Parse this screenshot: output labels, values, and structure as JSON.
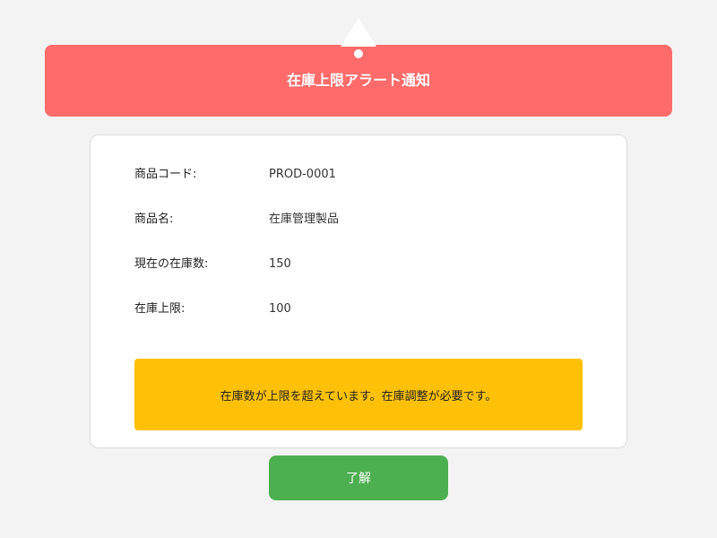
{
  "header": {
    "title": "在庫上限アラート通知",
    "icon": "warning-icon",
    "background_color": "#ff6b6b"
  },
  "details": {
    "rows": [
      {
        "label": "商品コード:",
        "value": "PROD-0001"
      },
      {
        "label": "商品名:",
        "value": "在庫管理製品"
      },
      {
        "label": "現在の在庫数:",
        "value": "150"
      },
      {
        "label": "在庫上限:",
        "value": "100"
      }
    ]
  },
  "alert": {
    "message": "在庫数が上限を超えています。在庫調整が必要です。",
    "background_color": "#ffc107"
  },
  "actions": {
    "acknowledge_label": "了解",
    "button_color": "#4caf50"
  }
}
